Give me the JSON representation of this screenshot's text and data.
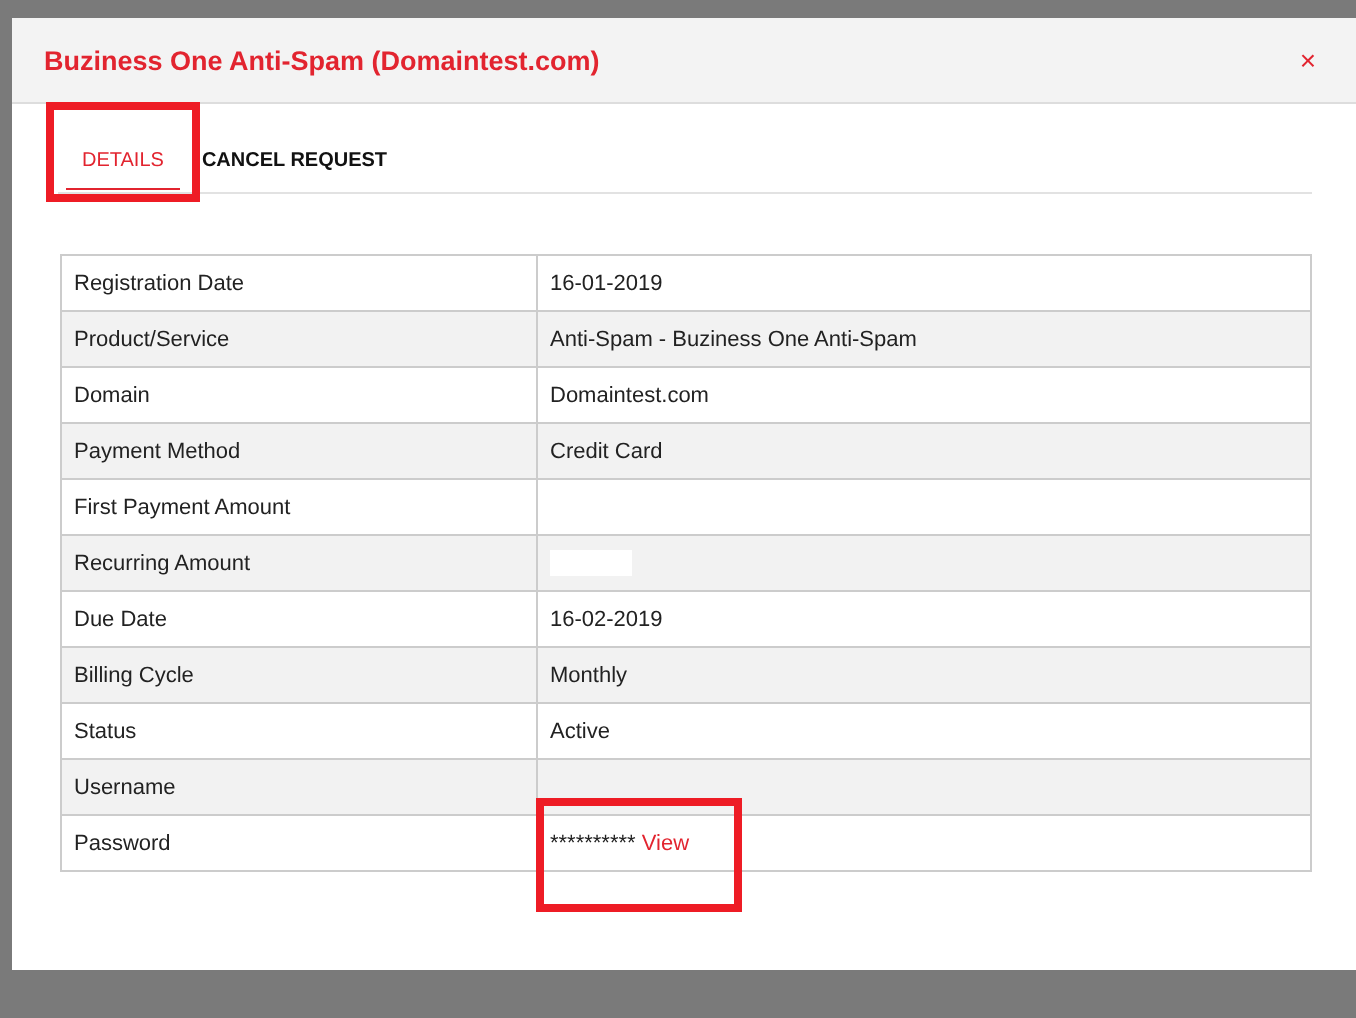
{
  "modal": {
    "title": "Buziness One Anti-Spam (Domaintest.com)",
    "close": "×"
  },
  "tabs": [
    {
      "label": "DETAILS",
      "selected": true,
      "highlighted": true
    },
    {
      "label": "CANCEL REQUEST",
      "selected": false,
      "highlighted": false
    }
  ],
  "rows": [
    {
      "label": "Registration Date",
      "value": "16-01-2019"
    },
    {
      "label": "Product/Service",
      "value": "Anti-Spam - Buziness One Anti-Spam"
    },
    {
      "label": "Domain",
      "value": "Domaintest.com"
    },
    {
      "label": "Payment Method",
      "value": "Credit Card"
    },
    {
      "label": "First Payment Amount"
    },
    {
      "label": "Recurring Amount",
      "redacted": true
    },
    {
      "label": "Due Date",
      "value": "16-02-2019"
    },
    {
      "label": "Billing Cycle",
      "value": "Monthly"
    },
    {
      "label": "Status",
      "value": "Active"
    },
    {
      "label": "Username"
    },
    {
      "label": "Password",
      "value": "**********",
      "link": "View",
      "highlighted": true
    }
  ]
}
